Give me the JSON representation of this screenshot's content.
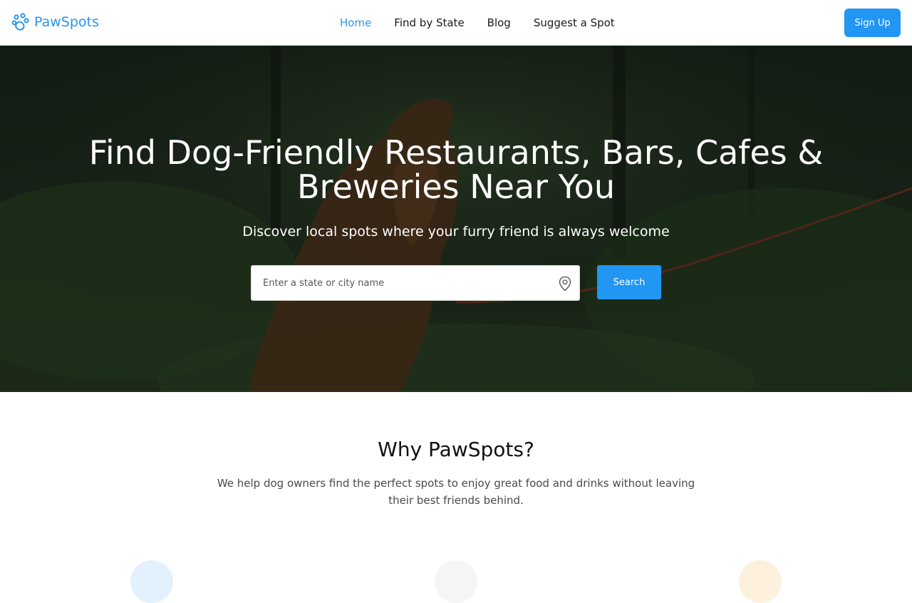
{
  "brand": {
    "name": "PawSpots",
    "icon": "paw-icon",
    "color": "#2b95e9"
  },
  "nav": {
    "links": [
      {
        "label": "Home",
        "active": true
      },
      {
        "label": "Find by State",
        "active": false
      },
      {
        "label": "Blog",
        "active": false
      },
      {
        "label": "Suggest a Spot",
        "active": false
      }
    ],
    "signup_label": "Sign Up"
  },
  "hero": {
    "title": "Find Dog-Friendly Restaurants, Bars, Cafes & Breweries Near You",
    "subtitle": "Discover local spots where your furry friend is always welcome",
    "search": {
      "placeholder": "Enter a state or city name",
      "value": "",
      "icon": "map-pin-icon",
      "button_label": "Search"
    }
  },
  "why": {
    "title": "Why PawSpots?",
    "description": "We help dog owners find the perfect spots to enjoy great food and drinks without leaving their best friends behind."
  },
  "colors": {
    "accent": "#2196f3",
    "link_active": "#2b95e9"
  }
}
